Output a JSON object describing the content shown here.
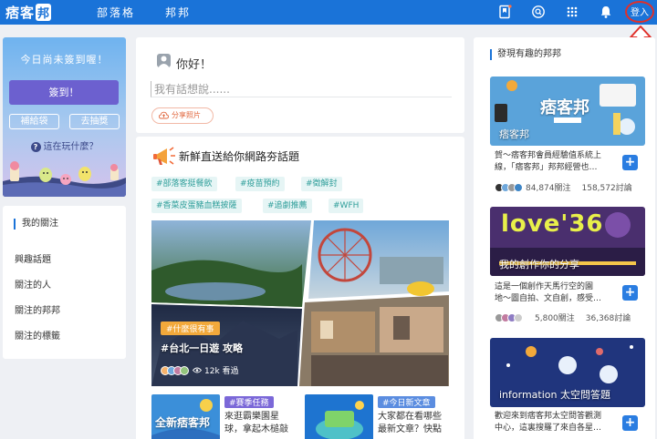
{
  "header": {
    "logo_text": "痞客",
    "logo_box": "邦",
    "nav": [
      "部落格",
      "邦邦"
    ],
    "login_label": "登入",
    "icons": [
      "bookmark-icon",
      "search-icon",
      "apps-grid-icon",
      "bell-icon"
    ]
  },
  "signin": {
    "title": "今日尚未簽到喔！",
    "button": "簽到！",
    "bag_button": "補給袋",
    "lottery_button": "去抽獎",
    "help_text": "這在玩什麼？",
    "help_icon": "?"
  },
  "follow": {
    "heading": "我的關注",
    "items": [
      "興趣話題",
      "關注的人",
      "關注的邦邦",
      "關注的標籤"
    ]
  },
  "composer": {
    "greeting": "你好！",
    "placeholder": "我有話想說......",
    "share_photo": "分享照片"
  },
  "topics": {
    "title": "新鮮直送給你網路夯話題",
    "tags": [
      "#部落客挺餐飲",
      "#疫苗預約",
      "#徵解封",
      "#香菜皮蛋豬血糕披薩",
      "#追劇推薦",
      "#WFH"
    ],
    "feature": {
      "label": "#什麼很有事",
      "title": "#台北一日遊 攻略",
      "views": "12k 看過"
    },
    "sub_cards": [
      {
        "tag": "#賽季任務",
        "thumb_text": "全新痞客邦",
        "text_line1": "來逛霸樂園星",
        "text_line2": "球，拿起木槌敲"
      },
      {
        "tag": "#今日新文章",
        "thumb_text": "",
        "text_line1": "大家都在看哪些",
        "text_line2": "最新文章？快點"
      }
    ]
  },
  "discover": {
    "heading": "發現有趣的邦邦",
    "boards": [
      {
        "name": "痞客邦",
        "img_title": "痞客邦",
        "desc_line1": "賀～痞客邦會員經驗值系統上",
        "desc_line2": "線，「痞客邦」邦邦經營也…",
        "followers": "84,874關注",
        "posts": "158,572討論"
      },
      {
        "name": "我的創作你的分享",
        "img_title": "love'36",
        "desc_line1": "這是一個創作天馬行空的園",
        "desc_line2": "地～圖自拍、文自創，感受…",
        "followers": "5,800關注",
        "posts": "36,368討論"
      },
      {
        "name": "information 太空問答題",
        "img_title": "",
        "desc_line1": "歡迎來到痞客邦太空問答觀測",
        "desc_line2": "中心，這裏搜羅了來自各星…",
        "followers": "",
        "posts": ""
      }
    ]
  },
  "colors": {
    "brand_blue": "#1a73d8",
    "signin_purple": "#6c60cf",
    "tag_teal": "#2f9e9a",
    "annotation_red": "#e0302a"
  }
}
